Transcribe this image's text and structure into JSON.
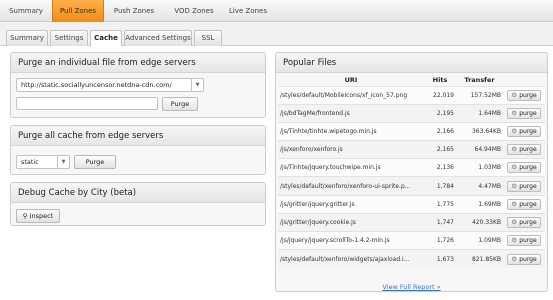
{
  "top_nav": {
    "tabs": [
      "Summary",
      "Pull Zones",
      "Push Zones",
      "VOD Zones",
      "Live Zones"
    ],
    "active": "Pull Zones"
  },
  "sub_tabs": {
    "tabs": [
      "Summary",
      "Settings",
      "Cache",
      "Advanced Settings",
      "SSL"
    ],
    "active": "Cache"
  },
  "purge_file": {
    "title": "Purge an individual file from edge servers",
    "select_value": "http://static.sociallyuncensor.netdna-cdn.com/",
    "input_value": "",
    "button": "Purge"
  },
  "purge_all": {
    "title": "Purge all cache from edge servers",
    "select_value": "static",
    "button": "Purge"
  },
  "debug": {
    "title": "Debug Cache by City (beta)",
    "button": "Inspect"
  },
  "popular_files": {
    "title": "Popular Files",
    "columns": [
      "URI",
      "Hits",
      "Transfer"
    ],
    "purge_label": "purge",
    "rows": [
      {
        "uri": "/styles/default/MobileIcons/xf_icon_57.png",
        "hits": "22,019",
        "transfer": "157.52MB"
      },
      {
        "uri": "/js/bdTagMe/frontend.js",
        "hits": "2,195",
        "transfer": "1.64MB"
      },
      {
        "uri": "/js/Tinhte/tinhte.wipetogo.min.js",
        "hits": "2,166",
        "transfer": "363.64KB"
      },
      {
        "uri": "/js/xenforo/xenforo.js",
        "hits": "2,165",
        "transfer": "64.94MB"
      },
      {
        "uri": "/js/Tinhte/jquery.touchwipe.min.js",
        "hits": "2,136",
        "transfer": "1.03MB"
      },
      {
        "uri": "/styles/default/xenforo/xenforo-ui-sprite.p...",
        "hits": "1,784",
        "transfer": "4.47MB"
      },
      {
        "uri": "/js/gritter/jquery.gritter.js",
        "hits": "1,775",
        "transfer": "1.69MB"
      },
      {
        "uri": "/js/gritter/jquery.cookie.js",
        "hits": "1,747",
        "transfer": "420.33KB"
      },
      {
        "uri": "/js/jquery/jquery.scrollTo-1.4.2-min.js",
        "hits": "1,726",
        "transfer": "1.09MB"
      },
      {
        "uri": "/styles/default/xenforo/widgets/ajaxload.i...",
        "hits": "1,673",
        "transfer": "821.85KB"
      }
    ],
    "footer_link": "View Full Report »"
  }
}
